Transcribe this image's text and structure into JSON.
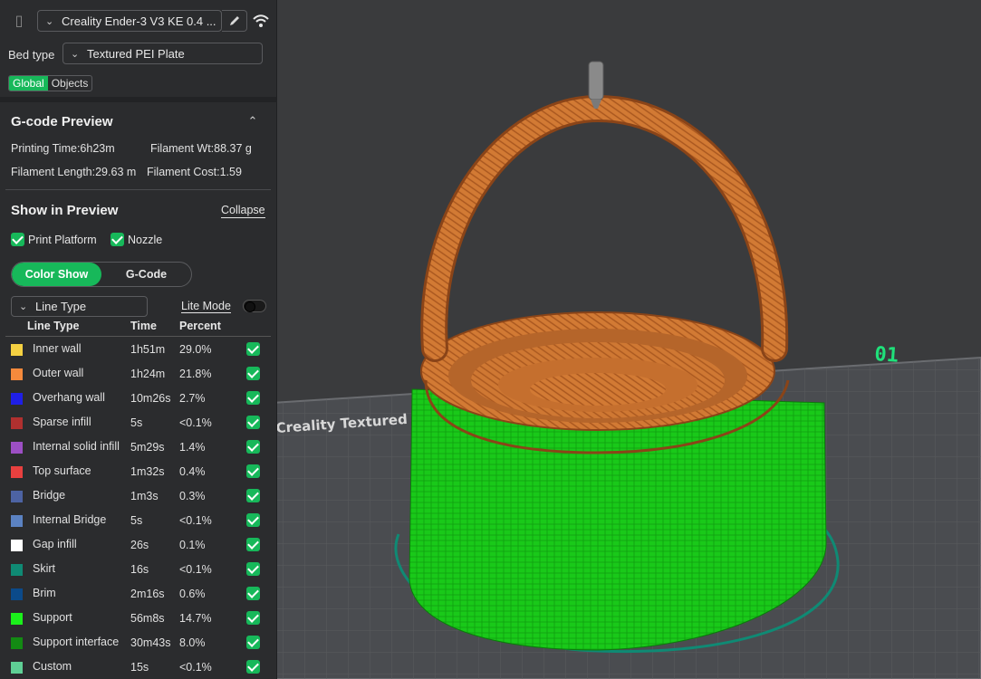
{
  "printer": {
    "name": "Creality Ender-3 V3 KE 0.4 ...",
    "bed_type_label": "Bed type",
    "bed_type_value": "Textured PEI Plate",
    "tabs": [
      "Global",
      "Objects"
    ],
    "active_tab": "Global"
  },
  "gcode_preview": {
    "title": "G-code Preview",
    "printing_time": "Printing Time:6h23m",
    "filament_weight": "Filament Wt:88.37 g",
    "filament_length": "Filament Length:29.63 m",
    "filament_cost": "Filament Cost:1.59"
  },
  "show_in_preview": {
    "title": "Show in Preview",
    "collapse_label": "Collapse",
    "print_platform_label": "Print Platform",
    "nozzle_label": "Nozzle",
    "modes": [
      "Color Show",
      "G-Code"
    ],
    "active_mode": "Color Show",
    "view_type": "Line Type",
    "lite_mode_label": "Lite Mode",
    "lite_mode_on": false
  },
  "line_table": {
    "headers": [
      "Line Type",
      "Time",
      "Percent"
    ],
    "rows": [
      {
        "name": "Inner wall",
        "time": "1h51m",
        "percent": "29.0%",
        "color": "#f5d142",
        "checked": true
      },
      {
        "name": "Outer wall",
        "time": "1h24m",
        "percent": "21.8%",
        "color": "#f58a3c",
        "checked": true
      },
      {
        "name": "Overhang wall",
        "time": "10m26s",
        "percent": "2.7%",
        "color": "#1f1fe6",
        "checked": true
      },
      {
        "name": "Sparse infill",
        "time": "5s",
        "percent": "<0.1%",
        "color": "#b0302f",
        "checked": true
      },
      {
        "name": "Internal solid infill",
        "time": "5m29s",
        "percent": "1.4%",
        "color": "#9c4fc4",
        "checked": true
      },
      {
        "name": "Top surface",
        "time": "1m32s",
        "percent": "0.4%",
        "color": "#e8403f",
        "checked": true
      },
      {
        "name": "Bridge",
        "time": "1m3s",
        "percent": "0.3%",
        "color": "#4d63a3",
        "checked": true
      },
      {
        "name": "Internal Bridge",
        "time": "5s",
        "percent": "<0.1%",
        "color": "#5b82c2",
        "checked": true
      },
      {
        "name": "Gap infill",
        "time": "26s",
        "percent": "0.1%",
        "color": "#ffffff",
        "checked": true
      },
      {
        "name": "Skirt",
        "time": "16s",
        "percent": "<0.1%",
        "color": "#0f8a74",
        "checked": true
      },
      {
        "name": "Brim",
        "time": "2m16s",
        "percent": "0.6%",
        "color": "#0b4a8a",
        "checked": true
      },
      {
        "name": "Support",
        "time": "56m8s",
        "percent": "14.7%",
        "color": "#1bf01b",
        "checked": true
      },
      {
        "name": "Support interface",
        "time": "30m43s",
        "percent": "8.0%",
        "color": "#138a13",
        "checked": true
      },
      {
        "name": "Custom",
        "time": "15s",
        "percent": "<0.1%",
        "color": "#5fcf95",
        "checked": true
      }
    ]
  },
  "viewport": {
    "plate_label": "Creality Textured",
    "plate_number": "01"
  }
}
